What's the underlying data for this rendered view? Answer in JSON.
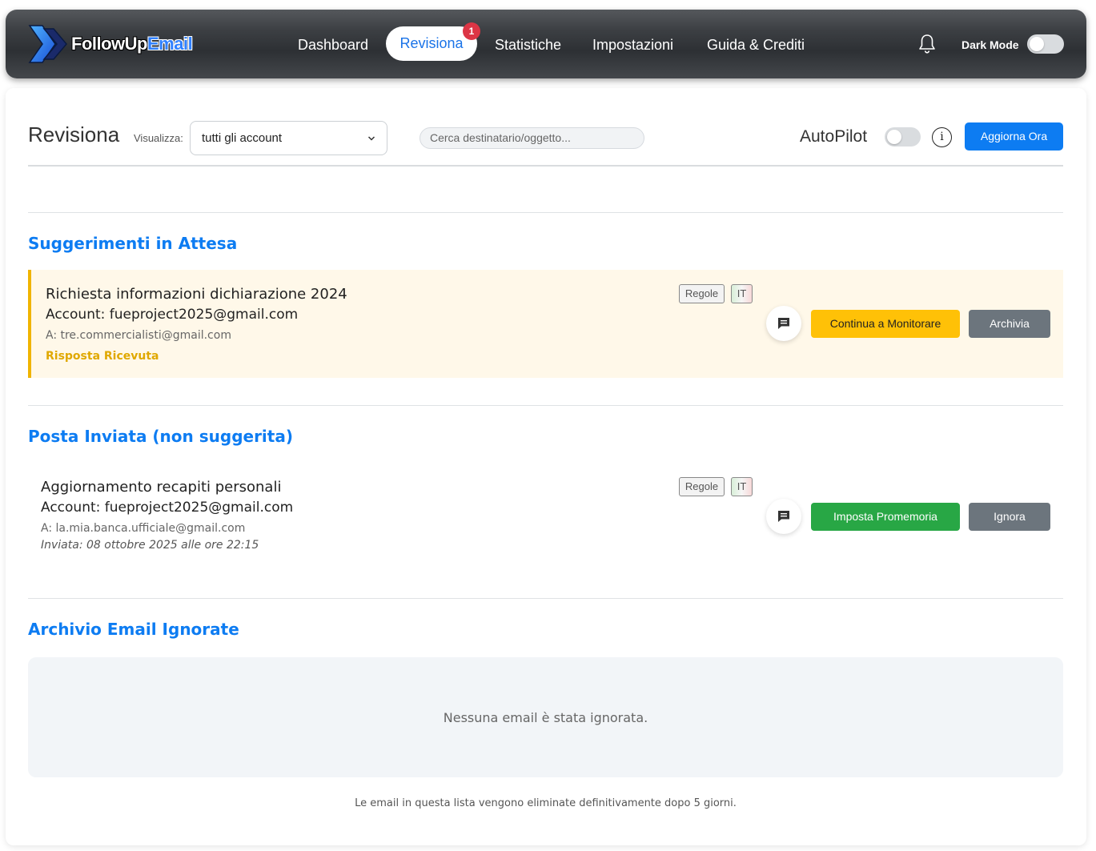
{
  "app": {
    "logo_text_white": "FollowUp",
    "logo_text_blue": "Email"
  },
  "nav": {
    "items": [
      {
        "label": "Dashboard"
      },
      {
        "label": "Revisiona",
        "active": true,
        "badge": "1"
      },
      {
        "label": "Statistiche"
      },
      {
        "label": "Impostazioni"
      },
      {
        "label": "Guida & Crediti"
      }
    ],
    "dark_mode_label": "Dark Mode",
    "dark_mode_on": false,
    "bell_icon": "bell-icon"
  },
  "toolbar": {
    "title": "Revisiona",
    "view_label": "Visualizza:",
    "view_selected": "tutti gli account",
    "search_placeholder": "Cerca destinatario/oggetto...",
    "autopilot_label": "AutoPilot",
    "autopilot_on": false,
    "info_symbol": "i",
    "refresh_label": "Aggiorna Ora"
  },
  "sections": {
    "pending": {
      "title": "Suggerimenti in Attesa",
      "items": [
        {
          "subject": "Richiesta informazioni dichiarazione 2024",
          "account": "Account: fueproject2025@gmail.com",
          "to": "A: tre.commercialisti@gmail.com",
          "status": "Risposta Ricevuta",
          "tags": [
            "Regole",
            "IT"
          ],
          "primary_action": "Continua a Monitorare",
          "secondary_action": "Archivia"
        }
      ]
    },
    "sent": {
      "title": "Posta Inviata (non suggerita)",
      "items": [
        {
          "subject": "Aggiornamento recapiti personali",
          "account": "Account: fueproject2025@gmail.com",
          "to": "A: la.mia.banca.ufficiale@gmail.com",
          "sent_date": "Inviata: 08 ottobre 2025 alle ore 22:15",
          "tags": [
            "Regole",
            "IT"
          ],
          "primary_action": "Imposta Promemoria",
          "secondary_action": "Ignora"
        }
      ]
    },
    "ignored": {
      "title": "Archivio Email Ignorate",
      "empty_text": "Nessuna email è stata ignorata.",
      "footnote": "Le email in questa lista vengono eliminate definitivamente dopo 5 giorni."
    }
  },
  "colors": {
    "accent": "#0d7cf2",
    "warning": "#ffc107",
    "success": "#28a745",
    "secondary": "#6c757d",
    "danger": "#dc3545"
  }
}
